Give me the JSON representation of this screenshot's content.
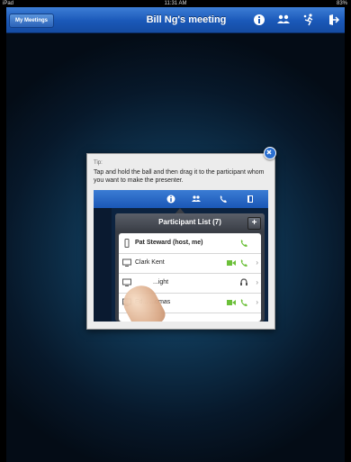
{
  "status_bar": {
    "device": "iPad",
    "time": "11:31 AM",
    "battery": "83%"
  },
  "nav_bar": {
    "back_label": "My Meetings",
    "title": "Bill Ng's meeting",
    "icons": [
      "info-icon",
      "participants-icon",
      "pass-ball-icon",
      "leave-icon"
    ]
  },
  "tip_popup": {
    "label": "Tip:",
    "text": "Tap and hold the ball and then drag it to the participant whom you want to make the presenter.",
    "illustration": {
      "toolbar_icons": [
        "info-icon",
        "participants-icon",
        "phone-icon",
        "exit-icon"
      ],
      "participant_list": {
        "title": "Participant List (7)",
        "add_label": "+",
        "rows": [
          {
            "name": "Pat Steward (host, me)",
            "device": "phone-device-icon",
            "icons": [
              "phone-icon"
            ]
          },
          {
            "name": "Clark Kent",
            "device": "computer-device-icon",
            "icons": [
              "video-icon",
              "phone-icon"
            ]
          },
          {
            "name": "...ight",
            "device": "computer-device-icon",
            "icons": [
              "headset-icon"
            ]
          },
          {
            "name": "Ed... ...omas",
            "device": "computer-device-icon",
            "icons": [
              "video-icon",
              "phone-icon"
            ]
          }
        ]
      }
    }
  },
  "colors": {
    "nav_blue": "#1a58b8",
    "background_dark": "#07182a",
    "phone_green": "#6cc03a"
  }
}
